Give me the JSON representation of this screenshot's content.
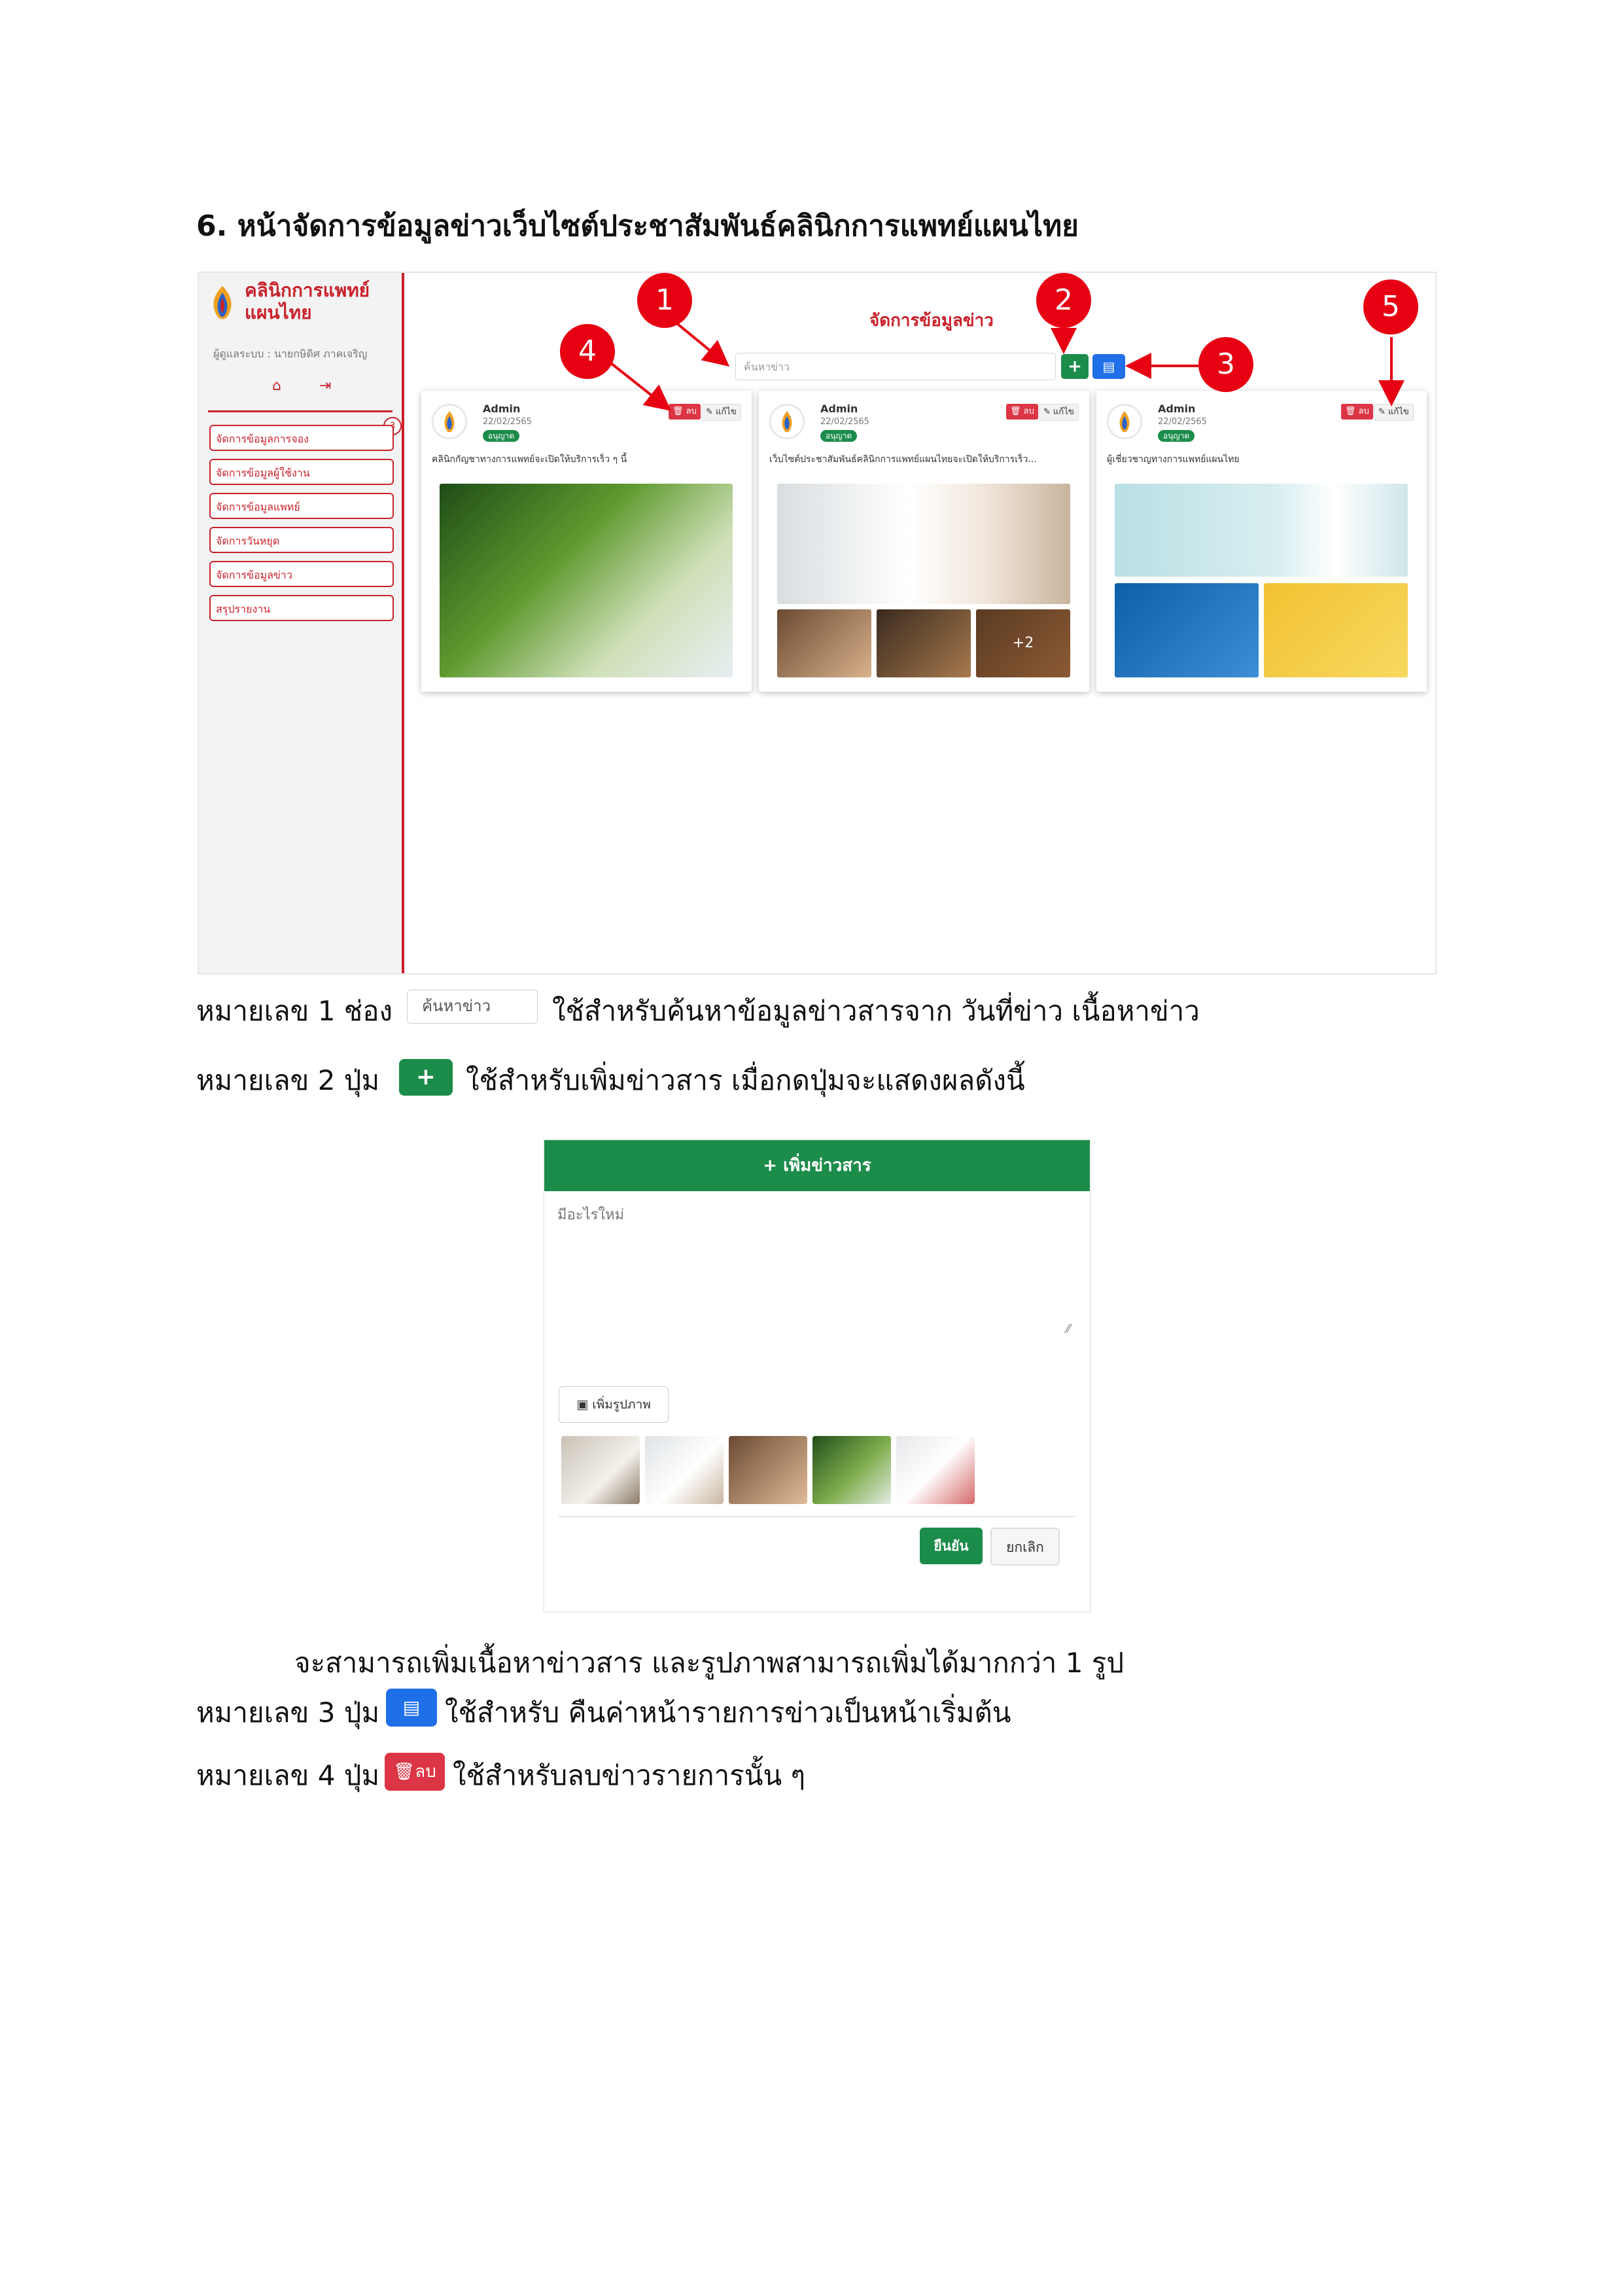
{
  "heading": "6. หน้าจัดการข้อมูลข่าวเว็บไซต์ประชาสัมพันธ์คลินิกการแพทย์แผนไทย",
  "screenshot1": {
    "brand_line1": "คลินิกการแพทย์",
    "brand_line2": "แผนไทย",
    "user_line": "ผู้ดูแลระบบ : นายกษิดิศ ภาคเจริญ",
    "menu_badge": "3",
    "menu": [
      "จัดการข้อมูลการจอง",
      "จัดการข้อมูลผู้ใช้งาน",
      "จัดการข้อมูลแพทย์",
      "จัดการวันหยุด",
      "จัดการข้อมูลข่าว",
      "สรุปรายงาน"
    ],
    "page_title": "จัดการข้อมูลข่าว",
    "search_placeholder": "ค้นหาข่าว",
    "add_icon": "+",
    "reset_icon": "▤",
    "cards": [
      {
        "author": "Admin",
        "date": "22/02/2565",
        "status": "อนุญาต",
        "delete_label": "ลบ",
        "edit_label": "แก้ไข",
        "text": "คลินิกกัญชาทางการแพทย์จะเปิดให้บริการเร็ว ๆ นี้"
      },
      {
        "author": "Admin",
        "date": "22/02/2565",
        "status": "อนุญาต",
        "delete_label": "ลบ",
        "edit_label": "แก้ไข",
        "text": "เว็บไซต์ประชาสัมพันธ์คลินิกการแพทย์แผนไทยจะเปิดให้บริการเร็ว...",
        "more_images": "+2"
      },
      {
        "author": "Admin",
        "date": "22/02/2565",
        "status": "อนุญาต",
        "delete_label": "ลบ",
        "edit_label": "แก้ไข",
        "text": "ผู้เชี่ยวชาญทางการแพทย์แผนไทย"
      }
    ],
    "markers": [
      "1",
      "2",
      "3",
      "4",
      "5"
    ]
  },
  "desc1_text": "หมายเลข 1 ช่อง",
  "desc1_search": "ค้นหาข่าว",
  "desc1_after": "ใช้สำหรับค้นหาข้อมูลข่าวสารจาก วันที่ข่าว เนื้อหาข่าว",
  "desc2_text": "หมายเลข 2 ปุ่ม",
  "desc2_button": "+",
  "desc2_after": "ใช้สำหรับเพิ่มข่าวสาร เมื่อกดปุ่มจะแสดงผลดังนี้",
  "modal": {
    "title": "+ เพิ่มข่าวสาร",
    "placeholder": "มีอะไรใหม่",
    "add_image_label": "เพิ่มรูปภาพ",
    "confirm_label": "ยืนยัน",
    "cancel_label": "ยกเลิก"
  },
  "para_after_modal": "จะสามารถเพิ่มเนื้อหาข่าวสาร และรูปภาพสามารถเพิ่มได้มากกว่า 1 รูป",
  "desc3_text": "หมายเลข 3 ปุ่ม",
  "desc3_after": "ใช้สำหรับ คืนค่าหน้ารายการข่าวเป็นหน้าเริ่มต้น",
  "desc4_text": "หมายเลข 4 ปุ่ม",
  "desc4_button": "ลบ",
  "desc4_after": "ใช้สำหรับลบข่าวรายการนั้น ๆ",
  "colors": {
    "red": "#c8222b",
    "green": "#1c8c4b",
    "blue": "#1f6fe8",
    "danger": "#dc3545",
    "marker": "#e60012"
  }
}
